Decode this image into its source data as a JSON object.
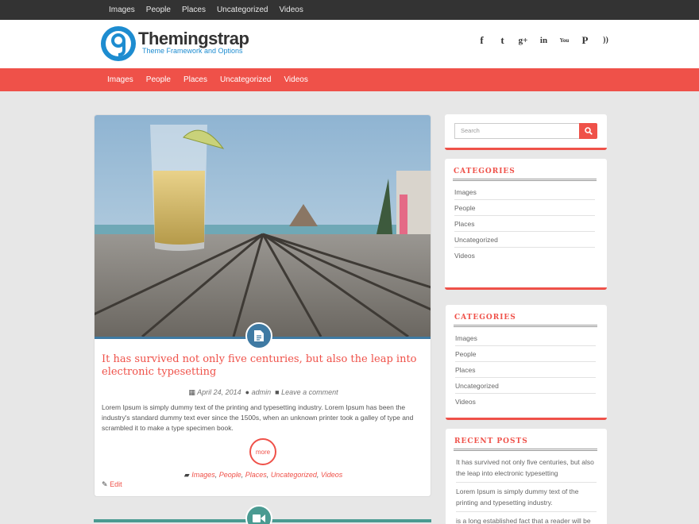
{
  "top_nav": [
    "Images",
    "People",
    "Places",
    "Uncategorized",
    "Videos"
  ],
  "brand": {
    "title": "Themingstrap",
    "tagline": "Theme Framework and Options",
    "accent": "#ef5149",
    "blue": "#1d8cd0"
  },
  "social": [
    {
      "icon": "facebook-icon",
      "glyph": "f"
    },
    {
      "icon": "twitter-icon",
      "glyph": "t"
    },
    {
      "icon": "google-plus-icon",
      "glyph": "g+"
    },
    {
      "icon": "linkedin-icon",
      "glyph": "in"
    },
    {
      "icon": "youtube-icon",
      "glyph": "You"
    },
    {
      "icon": "pinterest-icon",
      "glyph": "P"
    },
    {
      "icon": "rss-icon",
      "glyph": "))"
    }
  ],
  "main_nav": [
    "Images",
    "People",
    "Places",
    "Uncategorized",
    "Videos"
  ],
  "post": {
    "format_icon": "document-icon",
    "title": "It has survived not only five centuries, but also the leap into electronic typesetting",
    "date": "April 24, 2014",
    "author": "admin",
    "comments": "Leave a comment",
    "excerpt": "Lorem Ipsum is simply dummy text of the printing and typesetting industry. Lorem Ipsum has been the industry's standard dummy text ever since the 1500s, when an unknown printer took a galley of type and scrambled it to make a type specimen book.",
    "more_label": "more",
    "categories": [
      "Images",
      "People",
      "Places",
      "Uncategorized",
      "Videos"
    ],
    "edit_label": "Edit"
  },
  "next_post": {
    "format_icon": "video-camera-icon"
  },
  "sidebar": {
    "search_placeholder": "Search",
    "categories_1": {
      "title": "CATEGORIES",
      "items": [
        "Images",
        "People",
        "Places",
        "Uncategorized",
        "Videos"
      ]
    },
    "categories_2": {
      "title": "CATEGORIES",
      "items": [
        "Images",
        "People",
        "Places",
        "Uncategorized",
        "Videos"
      ]
    },
    "recent_posts": {
      "title": "RECENT POSTS",
      "items": [
        "It has survived not only five centuries, but also the leap into electronic typesetting",
        "Lorem Ipsum is simply dummy text of the printing and typesetting industry.",
        "is a long established fact that a reader will be"
      ]
    }
  }
}
